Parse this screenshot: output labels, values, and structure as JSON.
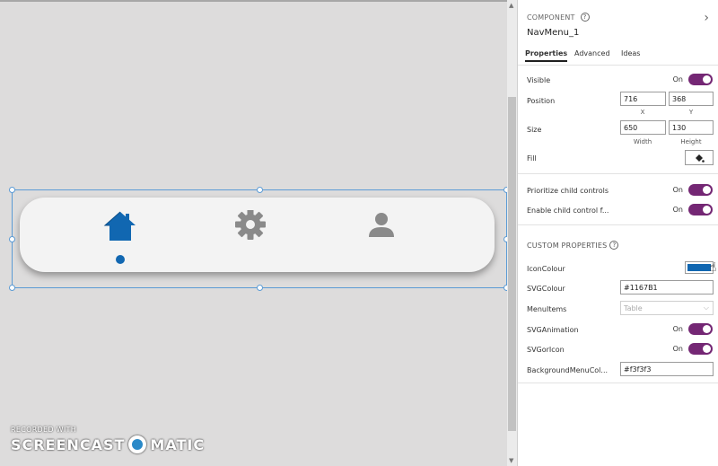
{
  "colors": {
    "accent_purple": "#742774",
    "icon_blue": "#1167B1",
    "icon_grey": "#8a8a8a",
    "menu_bg": "#f3f3f3",
    "selection_blue": "#5b9bd5"
  },
  "canvas": {
    "nav_items": [
      {
        "icon": "home-icon",
        "selected": true
      },
      {
        "icon": "gear-icon",
        "selected": false
      },
      {
        "icon": "person-icon",
        "selected": false
      }
    ],
    "watermark": {
      "line1": "RECORDED WITH",
      "brand_left": "SCREENCAST",
      "brand_right": "MATIC"
    }
  },
  "pane": {
    "component_label": "COMPONENT",
    "component_name": "NavMenu_1",
    "tabs": [
      {
        "label": "Properties",
        "active": true
      },
      {
        "label": "Advanced",
        "active": false
      },
      {
        "label": "Ideas",
        "active": false
      }
    ],
    "visible": {
      "label": "Visible",
      "state": "On"
    },
    "position": {
      "label": "Position",
      "x": "716",
      "y": "368",
      "x_label": "X",
      "y_label": "Y"
    },
    "size": {
      "label": "Size",
      "width": "650",
      "height": "130",
      "width_label": "Width",
      "height_label": "Height"
    },
    "fill": {
      "label": "Fill"
    },
    "prioritize": {
      "label": "Prioritize child controls",
      "state": "On"
    },
    "enable_child": {
      "label": "Enable child control f...",
      "state": "On"
    },
    "custom_title": "CUSTOM PROPERTIES",
    "icon_colour": {
      "label": "IconColour",
      "swatch": "#1167B1"
    },
    "svg_colour": {
      "label": "SVGColour",
      "value": "#1167B1"
    },
    "menu_items": {
      "label": "MenuItems",
      "value": "Table"
    },
    "svg_animation": {
      "label": "SVGAnimation",
      "state": "On"
    },
    "svg_or_icon": {
      "label": "SVGorIcon",
      "state": "On"
    },
    "background_menu": {
      "label": "BackgroundMenuCol...",
      "value": "#f3f3f3"
    }
  }
}
